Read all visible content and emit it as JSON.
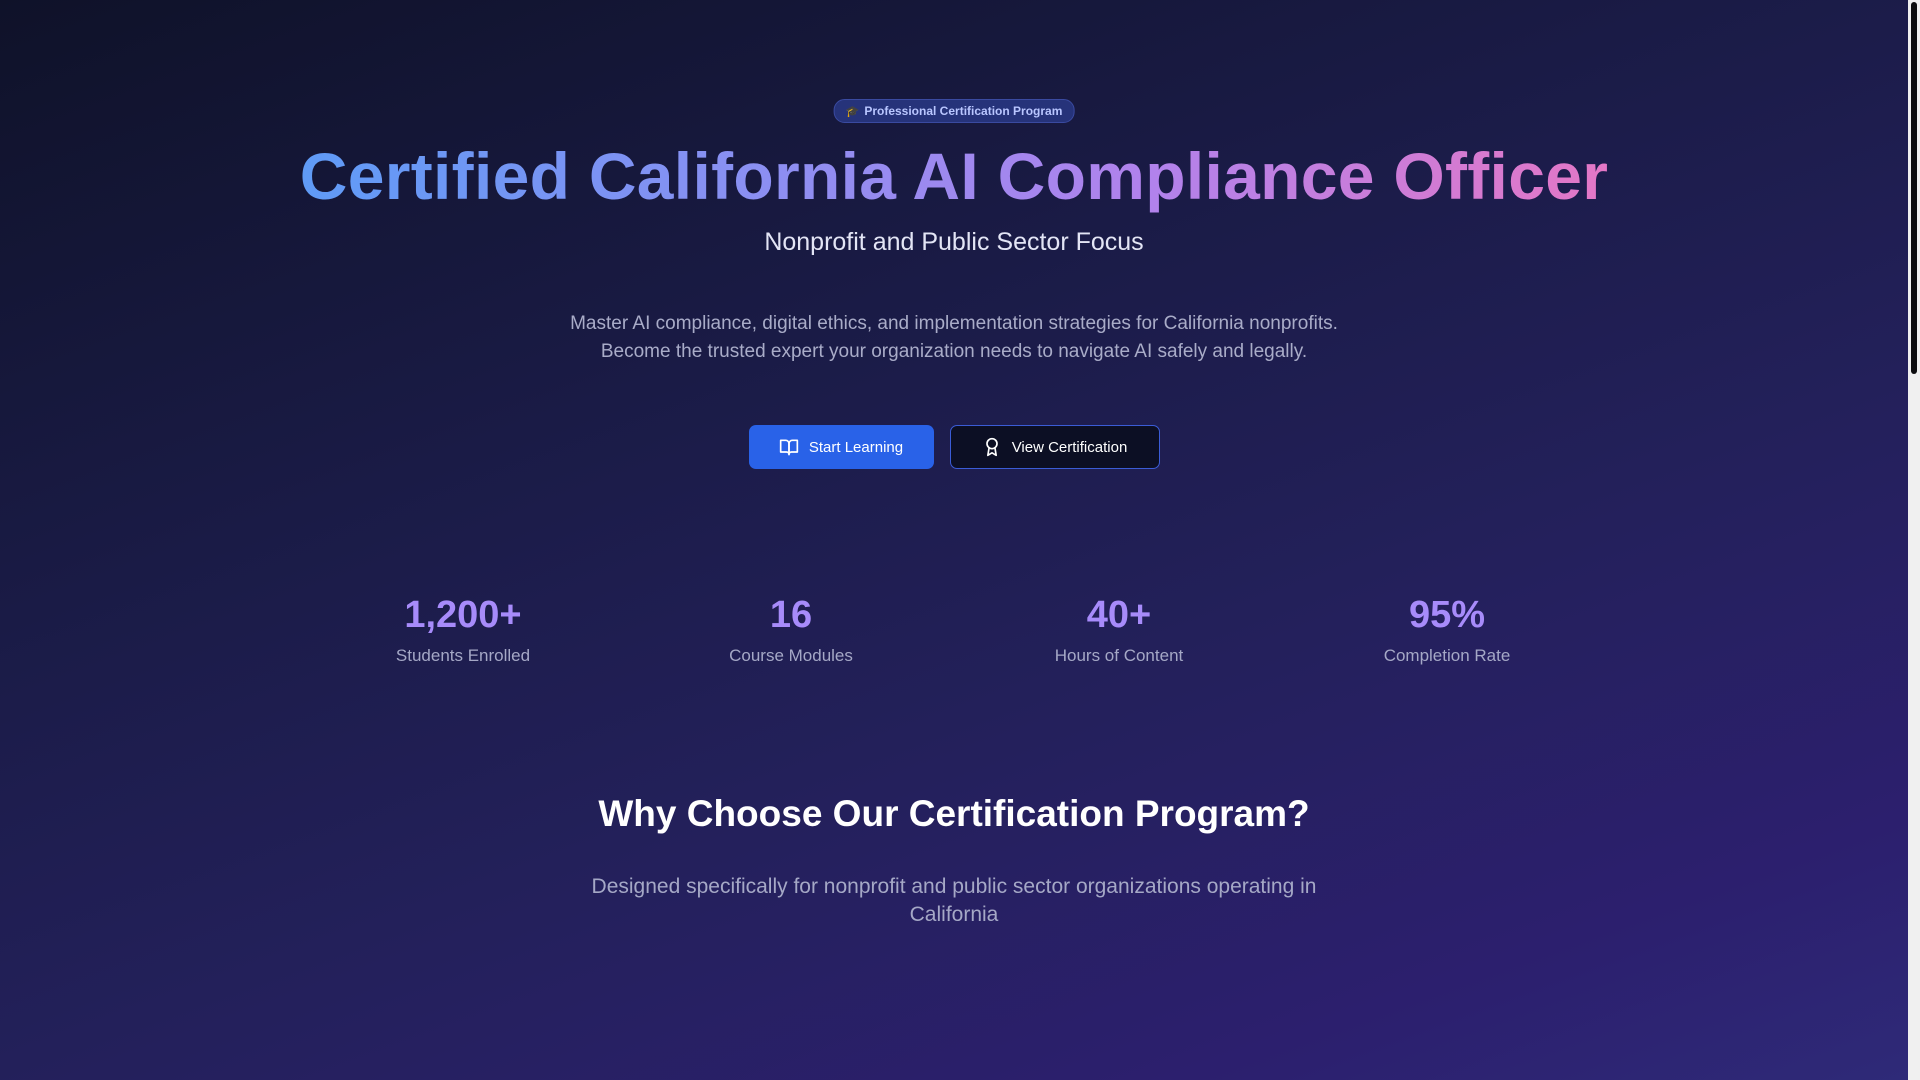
{
  "hero": {
    "badge": {
      "icon": "graduation-cap-icon",
      "label": "Professional Certification Program"
    },
    "title": "Certified California AI Compliance Officer",
    "subtitle": "Nonprofit and Public Sector Focus",
    "description": "Master AI compliance, digital ethics, and implementation strategies for California nonprofits. Become the trusted expert your organization needs to navigate AI safely and legally.",
    "buttons": {
      "primary": {
        "label": "Start Learning",
        "icon": "book-open-icon"
      },
      "secondary": {
        "label": "View Certification",
        "icon": "award-icon"
      }
    }
  },
  "stats": [
    {
      "value": "1,200+",
      "label": "Students Enrolled"
    },
    {
      "value": "16",
      "label": "Course Modules"
    },
    {
      "value": "40+",
      "label": "Hours of Content"
    },
    {
      "value": "95%",
      "label": "Completion Rate"
    }
  ],
  "why": {
    "title": "Why Choose Our Certification Program?",
    "description": "Designed specifically for nonprofit and public sector organizations operating in California"
  },
  "colors": {
    "accent": "#2962e8",
    "stat": "#a78bfa",
    "gradient_start": "#5f9bf6",
    "gradient_end": "#e477c6",
    "background": "#1a1b46"
  }
}
